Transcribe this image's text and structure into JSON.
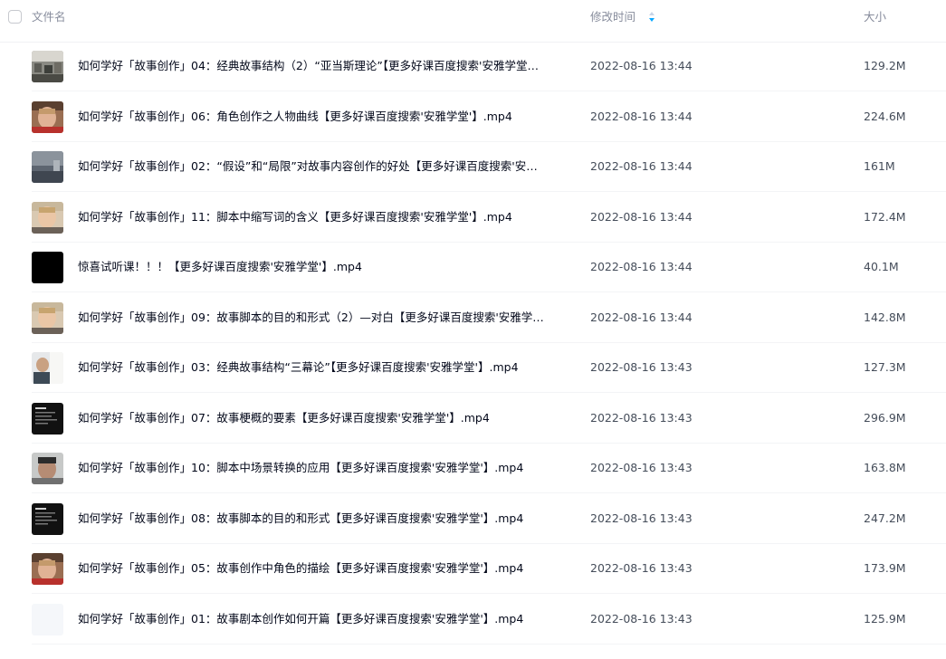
{
  "header": {
    "col_name": "文件名",
    "col_time": "修改时间",
    "col_size": "大小",
    "sort_icon": "sort-icon",
    "sort_color": "#06a7ff"
  },
  "files": [
    {
      "name": "如何学好「故事创作」04：经典故事结构（2）“亚当斯理论”【更多好课百度搜索'安雅学堂…",
      "modified": "2022-08-16 13:44",
      "size": "129.2M",
      "thumb": "office-room"
    },
    {
      "name": "如何学好「故事创作」06：角色创作之人物曲线【更多好课百度搜索'安雅学堂'】.mp4",
      "modified": "2022-08-16 13:44",
      "size": "224.6M",
      "thumb": "man-face-red"
    },
    {
      "name": "如何学好「故事创作」02：“假设”和“局限”对故事内容创作的好处【更多好课百度搜索'安…",
      "modified": "2022-08-16 13:44",
      "size": "161M",
      "thumb": "grey-scene"
    },
    {
      "name": "如何学好「故事创作」11：脚本中缩写词的含义【更多好课百度搜索'安雅学堂'】.mp4",
      "modified": "2022-08-16 13:44",
      "size": "172.4M",
      "thumb": "man-face-light"
    },
    {
      "name": "惊喜试听课！！！【更多好课百度搜索'安雅学堂'】.mp4",
      "modified": "2022-08-16 13:44",
      "size": "40.1M",
      "thumb": "black"
    },
    {
      "name": "如何学好「故事创作」09：故事脚本的目的和形式（2）—对白【更多好课百度搜索'安雅学…",
      "modified": "2022-08-16 13:44",
      "size": "142.8M",
      "thumb": "man-face-light"
    },
    {
      "name": "如何学好「故事创作」03：经典故事结构“三幕论”【更多好课百度搜索'安雅学堂'】.mp4",
      "modified": "2022-08-16 13:43",
      "size": "127.3M",
      "thumb": "person-whiteboard"
    },
    {
      "name": "如何学好「故事创作」07：故事梗概的要素【更多好课百度搜索'安雅学堂'】.mp4",
      "modified": "2022-08-16 13:43",
      "size": "296.9M",
      "thumb": "dark-text"
    },
    {
      "name": "如何学好「故事创作」10：脚本中场景转换的应用【更多好课百度搜索'安雅学堂'】.mp4",
      "modified": "2022-08-16 13:43",
      "size": "163.8M",
      "thumb": "man-face-grey"
    },
    {
      "name": "如何学好「故事创作」08：故事脚本的目的和形式【更多好课百度搜索'安雅学堂'】.mp4",
      "modified": "2022-08-16 13:43",
      "size": "247.2M",
      "thumb": "dark-text"
    },
    {
      "name": "如何学好「故事创作」05：故事创作中角色的描绘【更多好课百度搜索'安雅学堂'】.mp4",
      "modified": "2022-08-16 13:43",
      "size": "173.9M",
      "thumb": "man-face-red"
    },
    {
      "name": "如何学好「故事创作」01：故事剧本创作如何开篇【更多好课百度搜索'安雅学堂'】.mp4",
      "modified": "2022-08-16 13:43",
      "size": "125.9M",
      "thumb": "blank"
    }
  ]
}
